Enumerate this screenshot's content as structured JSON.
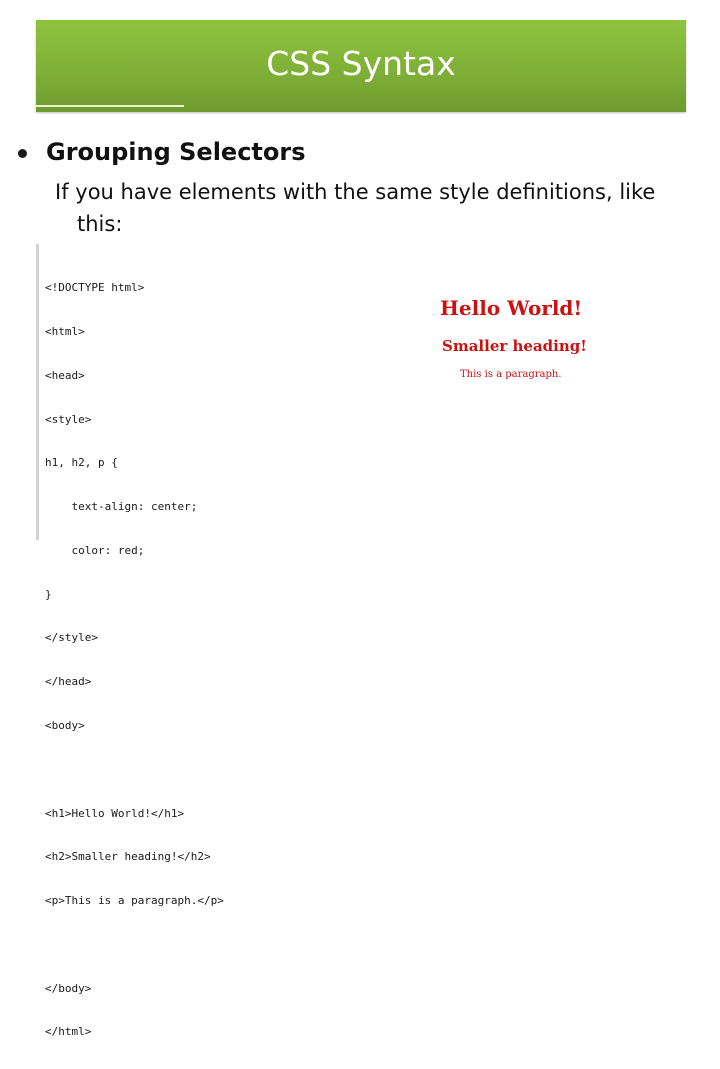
{
  "slide": {
    "title": "CSS Syntax",
    "bullet_heading": "Grouping Selectors",
    "body_line1": "If you have elements with the same style definitions, like",
    "body_line2": "this:"
  },
  "code": {
    "lines": [
      "<!DOCTYPE html>",
      "<html>",
      "<head>",
      "<style>",
      "h1, h2, p {",
      "    text-align: center;",
      "    color: red;",
      "}",
      "</style>",
      "</head>",
      "<body>",
      "",
      "<h1>Hello World!</h1>",
      "<h2>Smaller heading!</h2>",
      "<p>This is a paragraph.</p>",
      "",
      "</body>",
      "</html>"
    ]
  },
  "preview": {
    "h1": "Hello World!",
    "h2": "Smaller heading!",
    "p": "This is a paragraph."
  },
  "colors": {
    "title_bar": "#7eae36",
    "preview_text": "#cc1111"
  }
}
